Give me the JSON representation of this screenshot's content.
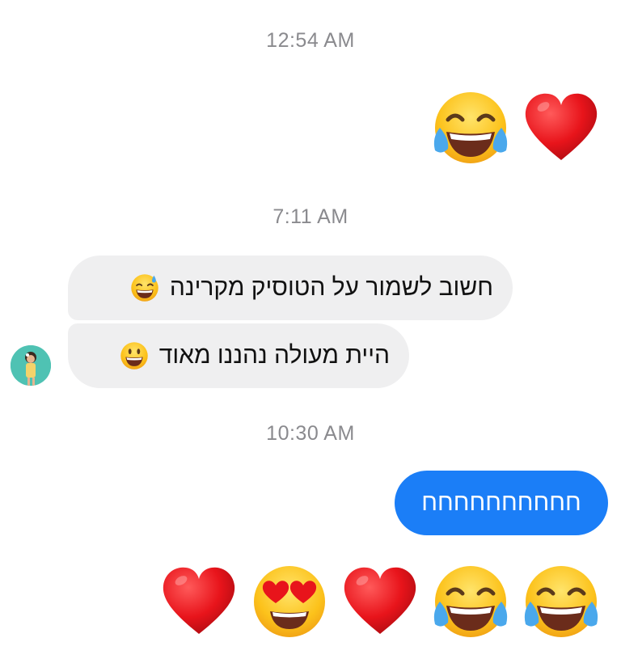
{
  "conversation": {
    "timestamps": {
      "t1": "12:54 AM",
      "t2": "7:11 AM",
      "t3": "10:30 AM"
    },
    "messages": {
      "incoming_1": "חשוב לשמור על הטוסיק מקרינה",
      "incoming_2": "היית מעולה נהננו מאוד",
      "outgoing_1": "חחחחחחחחחח"
    },
    "emoji_rows": {
      "row1": [
        "face-with-tears-of-joy-icon",
        "red-heart-icon"
      ],
      "row2": [
        "red-heart-icon",
        "smiling-face-with-heart-eyes-icon",
        "red-heart-icon",
        "face-with-tears-of-joy-icon",
        "face-with-tears-of-joy-icon"
      ]
    },
    "colors": {
      "outgoing_bubble": "#1b7ef7",
      "incoming_bubble": "#efeff0",
      "timestamp": "#8a8a8e"
    }
  }
}
